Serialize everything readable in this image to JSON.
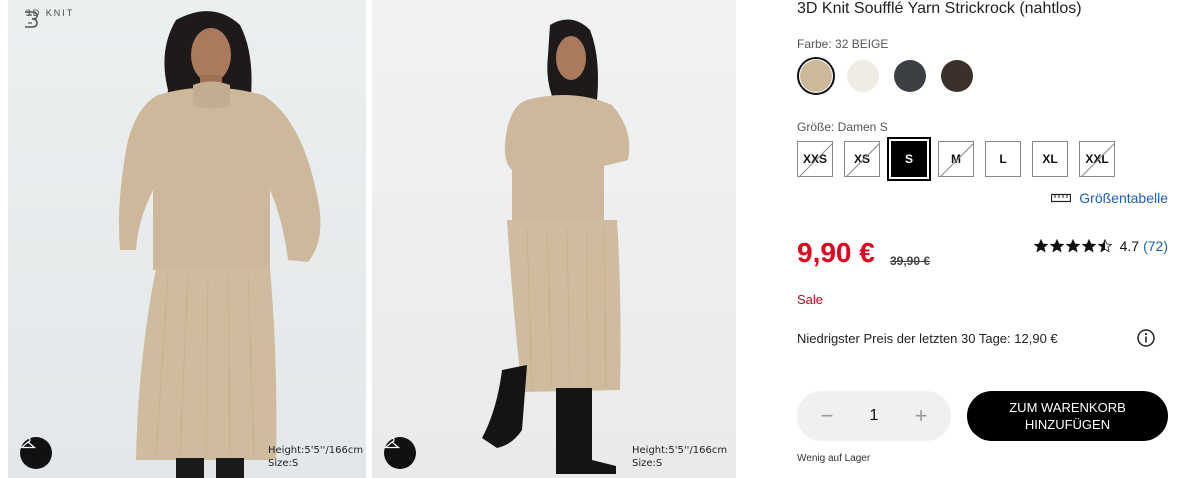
{
  "gallery": {
    "brand_mark": "3D KNIT",
    "images": [
      {
        "height": "Height:5'5''/166cm",
        "size": "Size:S"
      },
      {
        "height": "Height:5'5''/166cm",
        "size": "Size:S"
      }
    ]
  },
  "product": {
    "title": "3D Knit Soufflé Yarn Strickrock (nahtlos)",
    "color_label": "Farbe: 32 BEIGE",
    "colors": [
      {
        "name": "beige",
        "hex": "#cdb89a",
        "selected": true
      },
      {
        "name": "cream",
        "hex": "#efece6",
        "selected": false
      },
      {
        "name": "dark-grey",
        "hex": "#3c4045",
        "selected": false
      },
      {
        "name": "dark-brown",
        "hex": "#3b302b",
        "selected": false
      }
    ],
    "size_label": "Größe: Damen S",
    "sizes": [
      {
        "label": "XXS",
        "available": false,
        "selected": false
      },
      {
        "label": "XS",
        "available": false,
        "selected": false
      },
      {
        "label": "S",
        "available": true,
        "selected": true
      },
      {
        "label": "M",
        "available": false,
        "selected": false
      },
      {
        "label": "L",
        "available": true,
        "selected": false
      },
      {
        "label": "XL",
        "available": true,
        "selected": false
      },
      {
        "label": "XXL",
        "available": false,
        "selected": false
      }
    ],
    "size_guide": "Größentabelle",
    "price": "9,90 €",
    "old_price": "39,90 €",
    "rating": {
      "value": "4.7",
      "count": "(72)",
      "stars": 4.5
    },
    "sale": "Sale",
    "lowest_price": "Niedrigster Preis der letzten 30 Tage: 12,90 €",
    "quantity": "1",
    "cart_button": "ZUM WARENKORB HINZUFÜGEN",
    "stock": "Wenig auf Lager"
  },
  "colors": {
    "sale_red": "#e4001f",
    "link_blue": "#1f5fb5"
  }
}
